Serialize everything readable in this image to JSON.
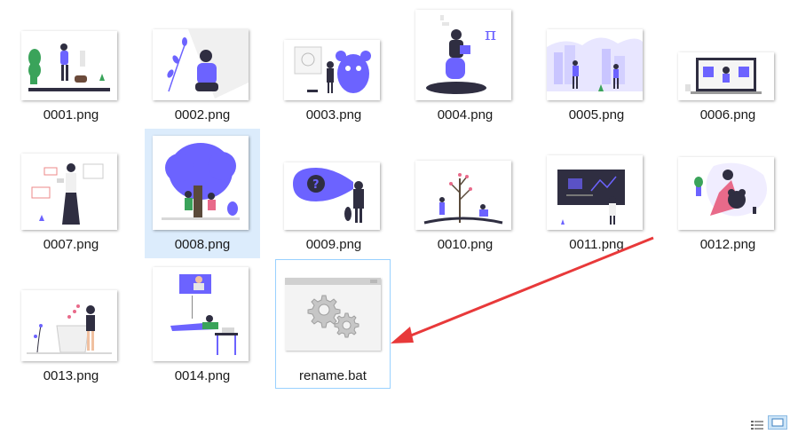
{
  "files": [
    {
      "name": "0001.png"
    },
    {
      "name": "0002.png"
    },
    {
      "name": "0003.png"
    },
    {
      "name": "0004.png"
    },
    {
      "name": "0005.png"
    },
    {
      "name": "0006.png"
    },
    {
      "name": "0007.png"
    },
    {
      "name": "0008.png"
    },
    {
      "name": "0009.png"
    },
    {
      "name": "0010.png"
    },
    {
      "name": "0011.png"
    },
    {
      "name": "0012.png"
    },
    {
      "name": "0013.png"
    },
    {
      "name": "0014.png"
    },
    {
      "name": "rename.bat"
    }
  ],
  "colors": {
    "accent": "#6c63ff",
    "dark": "#2f2e41",
    "selection": "#dcecfc",
    "focus_border": "#99d1ff",
    "arrow": "#e8393a"
  },
  "icons": {
    "batch_file": "gears-icon",
    "view_details": "details-view-icon",
    "view_large": "large-icons-view-icon"
  }
}
